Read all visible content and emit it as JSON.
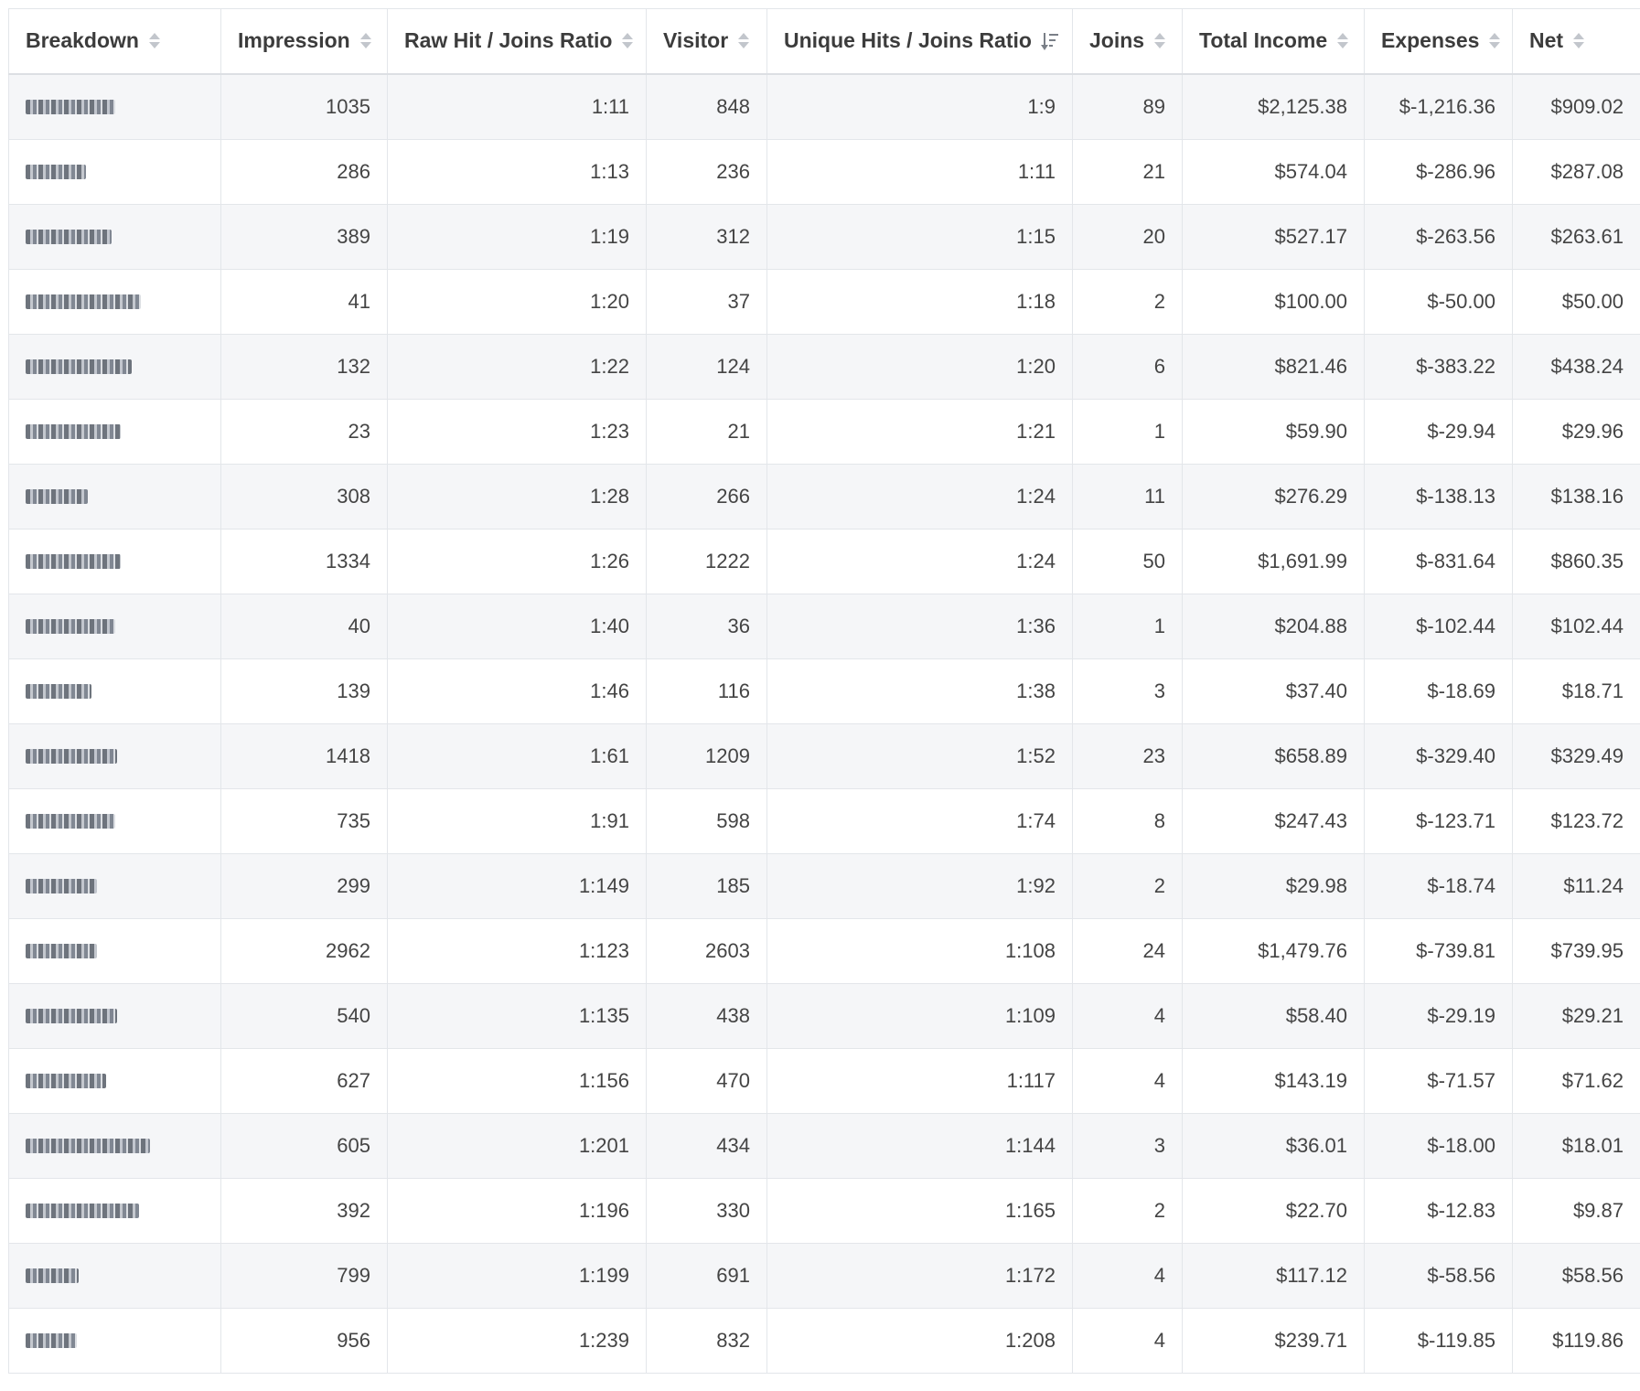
{
  "table": {
    "columns": [
      {
        "label": "Breakdown",
        "sort": "none"
      },
      {
        "label": "Impression",
        "sort": "none"
      },
      {
        "label": "Raw Hit / Joins Ratio",
        "sort": "none"
      },
      {
        "label": "Visitor",
        "sort": "none"
      },
      {
        "label": "Unique Hits / Joins Ratio",
        "sort": "desc"
      },
      {
        "label": "Joins",
        "sort": "none"
      },
      {
        "label": "Total Income",
        "sort": "none"
      },
      {
        "label": "Expenses",
        "sort": "none"
      },
      {
        "label": "Net",
        "sort": "none"
      }
    ],
    "rows": [
      {
        "impression": "1035",
        "raw_ratio": "1:11",
        "visitor": "848",
        "unique_ratio": "1:9",
        "joins": "89",
        "income": "$2,125.38",
        "expenses": "$-1,216.36",
        "net": "$909.02"
      },
      {
        "impression": "286",
        "raw_ratio": "1:13",
        "visitor": "236",
        "unique_ratio": "1:11",
        "joins": "21",
        "income": "$574.04",
        "expenses": "$-286.96",
        "net": "$287.08"
      },
      {
        "impression": "389",
        "raw_ratio": "1:19",
        "visitor": "312",
        "unique_ratio": "1:15",
        "joins": "20",
        "income": "$527.17",
        "expenses": "$-263.56",
        "net": "$263.61"
      },
      {
        "impression": "41",
        "raw_ratio": "1:20",
        "visitor": "37",
        "unique_ratio": "1:18",
        "joins": "2",
        "income": "$100.00",
        "expenses": "$-50.00",
        "net": "$50.00"
      },
      {
        "impression": "132",
        "raw_ratio": "1:22",
        "visitor": "124",
        "unique_ratio": "1:20",
        "joins": "6",
        "income": "$821.46",
        "expenses": "$-383.22",
        "net": "$438.24"
      },
      {
        "impression": "23",
        "raw_ratio": "1:23",
        "visitor": "21",
        "unique_ratio": "1:21",
        "joins": "1",
        "income": "$59.90",
        "expenses": "$-29.94",
        "net": "$29.96"
      },
      {
        "impression": "308",
        "raw_ratio": "1:28",
        "visitor": "266",
        "unique_ratio": "1:24",
        "joins": "11",
        "income": "$276.29",
        "expenses": "$-138.13",
        "net": "$138.16"
      },
      {
        "impression": "1334",
        "raw_ratio": "1:26",
        "visitor": "1222",
        "unique_ratio": "1:24",
        "joins": "50",
        "income": "$1,691.99",
        "expenses": "$-831.64",
        "net": "$860.35"
      },
      {
        "impression": "40",
        "raw_ratio": "1:40",
        "visitor": "36",
        "unique_ratio": "1:36",
        "joins": "1",
        "income": "$204.88",
        "expenses": "$-102.44",
        "net": "$102.44"
      },
      {
        "impression": "139",
        "raw_ratio": "1:46",
        "visitor": "116",
        "unique_ratio": "1:38",
        "joins": "3",
        "income": "$37.40",
        "expenses": "$-18.69",
        "net": "$18.71"
      },
      {
        "impression": "1418",
        "raw_ratio": "1:61",
        "visitor": "1209",
        "unique_ratio": "1:52",
        "joins": "23",
        "income": "$658.89",
        "expenses": "$-329.40",
        "net": "$329.49"
      },
      {
        "impression": "735",
        "raw_ratio": "1:91",
        "visitor": "598",
        "unique_ratio": "1:74",
        "joins": "8",
        "income": "$247.43",
        "expenses": "$-123.71",
        "net": "$123.72"
      },
      {
        "impression": "299",
        "raw_ratio": "1:149",
        "visitor": "185",
        "unique_ratio": "1:92",
        "joins": "2",
        "income": "$29.98",
        "expenses": "$-18.74",
        "net": "$11.24"
      },
      {
        "impression": "2962",
        "raw_ratio": "1:123",
        "visitor": "2603",
        "unique_ratio": "1:108",
        "joins": "24",
        "income": "$1,479.76",
        "expenses": "$-739.81",
        "net": "$739.95"
      },
      {
        "impression": "540",
        "raw_ratio": "1:135",
        "visitor": "438",
        "unique_ratio": "1:109",
        "joins": "4",
        "income": "$58.40",
        "expenses": "$-29.19",
        "net": "$29.21"
      },
      {
        "impression": "627",
        "raw_ratio": "1:156",
        "visitor": "470",
        "unique_ratio": "1:117",
        "joins": "4",
        "income": "$143.19",
        "expenses": "$-71.57",
        "net": "$71.62"
      },
      {
        "impression": "605",
        "raw_ratio": "1:201",
        "visitor": "434",
        "unique_ratio": "1:144",
        "joins": "3",
        "income": "$36.01",
        "expenses": "$-18.00",
        "net": "$18.01"
      },
      {
        "impression": "392",
        "raw_ratio": "1:196",
        "visitor": "330",
        "unique_ratio": "1:165",
        "joins": "2",
        "income": "$22.70",
        "expenses": "$-12.83",
        "net": "$9.87"
      },
      {
        "impression": "799",
        "raw_ratio": "1:199",
        "visitor": "691",
        "unique_ratio": "1:172",
        "joins": "4",
        "income": "$117.12",
        "expenses": "$-58.56",
        "net": "$58.56"
      },
      {
        "impression": "956",
        "raw_ratio": "1:239",
        "visitor": "832",
        "unique_ratio": "1:208",
        "joins": "4",
        "income": "$239.71",
        "expenses": "$-119.85",
        "net": "$119.86"
      }
    ]
  },
  "icons": {
    "sort_none": "sort-icon",
    "sort_desc": "sort-amount-down-icon"
  },
  "colors": {
    "row_stripe": "#f5f6f8",
    "border": "#e3e6ea",
    "text": "#444444"
  }
}
